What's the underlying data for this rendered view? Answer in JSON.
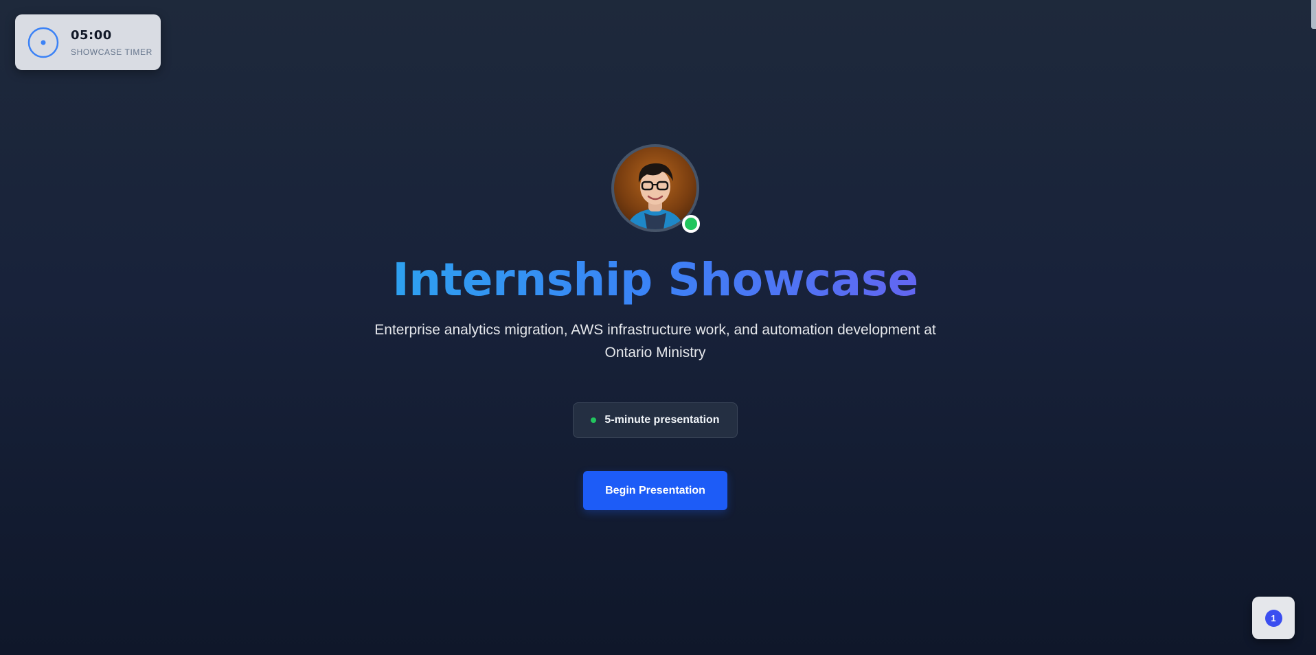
{
  "timer": {
    "time": "05:00",
    "caption": "SHOWCASE TIMER",
    "icon": "timer-ring-icon",
    "accent_color": "#3b82f6"
  },
  "hero": {
    "avatar_icon": "profile-photo",
    "status_color": "#22c55e",
    "title": "Internship Showcase",
    "subtitle": "Enterprise analytics migration, AWS infrastructure work, and automation development at Ontario Ministry",
    "duration_label": "5-minute presentation",
    "begin_label": "Begin Presentation",
    "button_color": "#1d5cf7"
  },
  "notification": {
    "count": "1",
    "badge_color": "#3b4ef0"
  }
}
